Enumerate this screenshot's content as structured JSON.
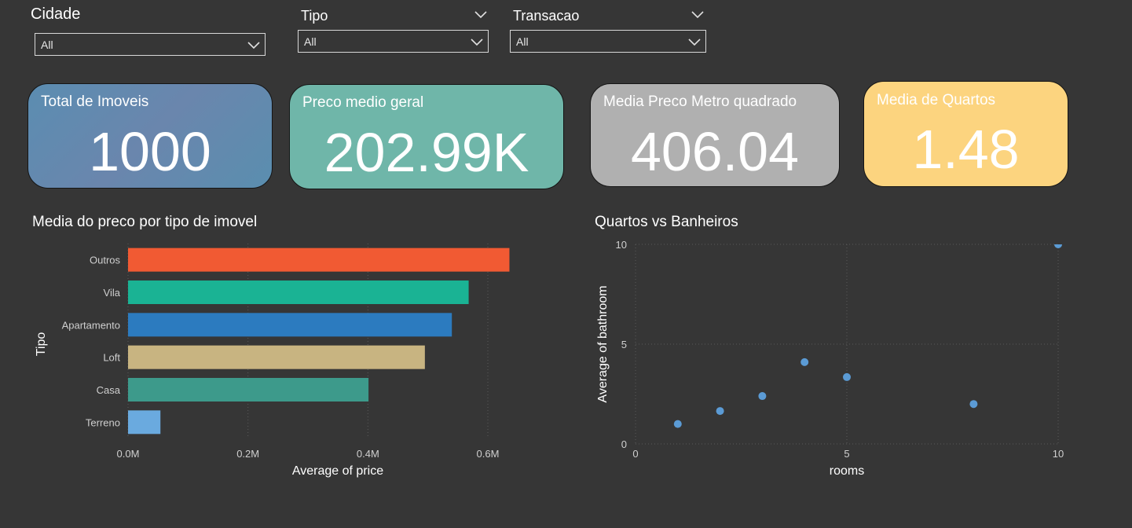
{
  "filters": {
    "cidade": {
      "label": "Cidade",
      "value": "All"
    },
    "tipo": {
      "label": "Tipo",
      "value": "All"
    },
    "transacao": {
      "label": "Transacao",
      "value": "All"
    }
  },
  "cards": {
    "total_imoveis": {
      "label": "Total de Imoveis",
      "value": "1000",
      "color": "#5b8db1"
    },
    "preco_medio": {
      "label": "Preco medio geral",
      "value": "202.99K",
      "color": "#6fb6a9"
    },
    "preco_m2": {
      "label": "Media Preco Metro quadrado",
      "value": "406.04",
      "color": "#b0b0b0"
    },
    "media_quartos": {
      "label": "Media de Quartos",
      "value": "1.48",
      "color": "#fcd47f"
    }
  },
  "chart_data": [
    {
      "type": "bar",
      "orientation": "horizontal",
      "title": "Media do preco por tipo de imovel",
      "xlabel": "Average of price",
      "ylabel": "Tipo",
      "categories": [
        "Outros",
        "Vila",
        "Apartamento",
        "Loft",
        "Casa",
        "Terreno"
      ],
      "values": [
        0.636,
        0.568,
        0.54,
        0.495,
        0.401,
        0.054
      ],
      "colors": [
        "#f15a33",
        "#1ab394",
        "#2c7bbf",
        "#c8b481",
        "#3d9a8b",
        "#6aaadf"
      ],
      "xticks": [
        "0.0M",
        "0.2M",
        "0.4M",
        "0.6M"
      ],
      "xtick_values": [
        0,
        0.2,
        0.4,
        0.6
      ],
      "xlim": [
        0,
        0.7
      ],
      "grid": true
    },
    {
      "type": "scatter",
      "title": "Quartos vs Banheiros",
      "xlabel": "rooms",
      "ylabel": "Average of bathroom",
      "points": [
        {
          "x": 1,
          "y": 1.0
        },
        {
          "x": 2,
          "y": 1.65
        },
        {
          "x": 3,
          "y": 2.4
        },
        {
          "x": 4,
          "y": 4.1
        },
        {
          "x": 5,
          "y": 3.35
        },
        {
          "x": 8,
          "y": 2.0
        },
        {
          "x": 10,
          "y": 10.0
        }
      ],
      "xticks": [
        "0",
        "5",
        "10"
      ],
      "xtick_values": [
        0,
        5,
        10
      ],
      "yticks": [
        "0",
        "5",
        "10"
      ],
      "ytick_values": [
        0,
        5,
        10
      ],
      "xlim": [
        0,
        10
      ],
      "ylim": [
        0,
        10
      ],
      "color": "#5b9bd5",
      "grid": true
    }
  ]
}
